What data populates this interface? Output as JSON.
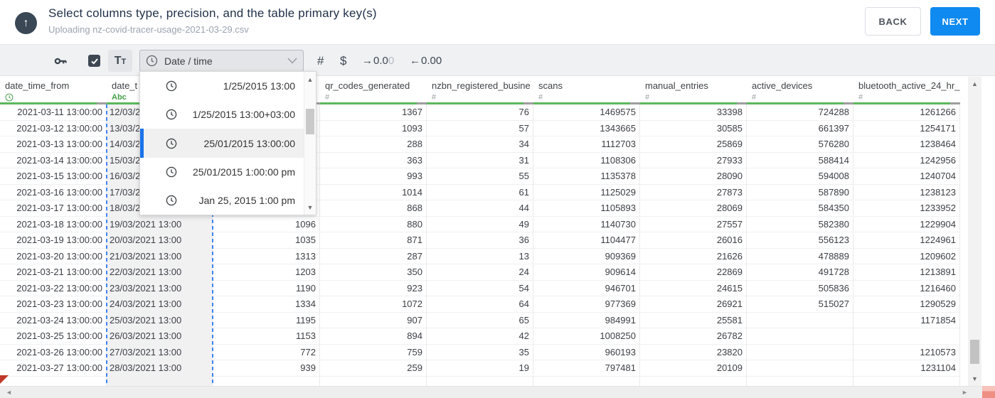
{
  "header": {
    "title": "Select columns type, precision, and the table primary key(s)",
    "subtitle": "Uploading nz-covid-tracer-usage-2021-03-29.csv",
    "back_label": "BACK",
    "next_label": "NEXT"
  },
  "toolbar": {
    "text_type_label": "Tt",
    "type_dropdown_value": "Date / time",
    "number_symbol": "#",
    "currency_symbol": "$",
    "increase_decimal": {
      "arrow": "→",
      "value": "0.0",
      "faded": "0"
    },
    "decrease_decimal": {
      "arrow": "←",
      "value": "0.00"
    },
    "checkbox_checked": true
  },
  "type_dropdown": {
    "selected_index": 2,
    "options": [
      {
        "label": "1/25/2015 13:00"
      },
      {
        "label": "1/25/2015 13:00+03:00"
      },
      {
        "label": "25/01/2015 13:00:00"
      },
      {
        "label": "25/01/2015 1:00:00 pm"
      },
      {
        "label": "Jan 25, 2015 1:00 pm"
      }
    ]
  },
  "table": {
    "columns": [
      {
        "name": "date_time_from",
        "type": "clock",
        "align": "right",
        "selected": false
      },
      {
        "name": "date_t",
        "type": "Abc",
        "align": "left",
        "selected": true
      },
      {
        "name": "",
        "type": "",
        "align": "right",
        "selected": false
      },
      {
        "name": "qr_codes_generated",
        "type": "#",
        "align": "right",
        "selected": false
      },
      {
        "name": "nzbn_registered_busine",
        "type": "#",
        "align": "right",
        "selected": false
      },
      {
        "name": "scans",
        "type": "#",
        "align": "right",
        "selected": false
      },
      {
        "name": "manual_entries",
        "type": "#",
        "align": "right",
        "selected": false
      },
      {
        "name": "active_devices",
        "type": "#",
        "align": "right",
        "selected": false
      },
      {
        "name": "bluetooth_active_24_hr_",
        "type": "#",
        "align": "right",
        "selected": false
      }
    ],
    "rows": [
      [
        "2021-03-11 13:00:00",
        "12/03/2",
        "",
        "1367",
        "76",
        "1469575",
        "33398",
        "724288",
        "1261266"
      ],
      [
        "2021-03-12 13:00:00",
        "13/03/2",
        "",
        "1093",
        "57",
        "1343665",
        "30585",
        "661397",
        "1254171"
      ],
      [
        "2021-03-13 13:00:00",
        "14/03/2",
        "",
        "288",
        "34",
        "1112703",
        "25869",
        "576280",
        "1238464"
      ],
      [
        "2021-03-14 13:00:00",
        "15/03/2",
        "",
        "363",
        "31",
        "1108306",
        "27933",
        "588414",
        "1242956"
      ],
      [
        "2021-03-15 13:00:00",
        "16/03/2",
        "",
        "993",
        "55",
        "1135378",
        "28090",
        "594008",
        "1240704"
      ],
      [
        "2021-03-16 13:00:00",
        "17/03/2",
        "",
        "1014",
        "61",
        "1125029",
        "27873",
        "587890",
        "1238123"
      ],
      [
        "2021-03-17 13:00:00",
        "18/03/2",
        "",
        "868",
        "44",
        "1105893",
        "28069",
        "584350",
        "1233952"
      ],
      [
        "2021-03-18 13:00:00",
        "19/03/2021 13:00",
        "1096",
        "880",
        "49",
        "1140730",
        "27557",
        "582380",
        "1229904"
      ],
      [
        "2021-03-19 13:00:00",
        "20/03/2021 13:00",
        "1035",
        "871",
        "36",
        "1104477",
        "26016",
        "556123",
        "1224961"
      ],
      [
        "2021-03-20 13:00:00",
        "21/03/2021 13:00",
        "1313",
        "287",
        "13",
        "909369",
        "21626",
        "478889",
        "1209602"
      ],
      [
        "2021-03-21 13:00:00",
        "22/03/2021 13:00",
        "1203",
        "350",
        "24",
        "909614",
        "22869",
        "491728",
        "1213891"
      ],
      [
        "2021-03-22 13:00:00",
        "23/03/2021 13:00",
        "1190",
        "923",
        "54",
        "946701",
        "24615",
        "505836",
        "1216460"
      ],
      [
        "2021-03-23 13:00:00",
        "24/03/2021 13:00",
        "1334",
        "1072",
        "64",
        "977369",
        "26921",
        "515027",
        "1290529"
      ],
      [
        "2021-03-24 13:00:00",
        "25/03/2021 13:00",
        "1195",
        "907",
        "65",
        "984991",
        "25581",
        "",
        "1171854"
      ],
      [
        "2021-03-25 13:00:00",
        "26/03/2021 13:00",
        "1153",
        "894",
        "42",
        "1008250",
        "26782",
        "",
        ""
      ],
      [
        "2021-03-26 13:00:00",
        "27/03/2021 13:00",
        "772",
        "759",
        "35",
        "960193",
        "23820",
        "",
        "1210573"
      ],
      [
        "2021-03-27 13:00:00",
        "28/03/2021 13:00",
        "939",
        "259",
        "19",
        "797481",
        "20109",
        "",
        "1231104"
      ]
    ]
  },
  "icons": {
    "upload_arrow": "↑",
    "scroll_up": "▲",
    "scroll_down": "▼",
    "scroll_left": "◄",
    "scroll_right": "►"
  },
  "colors": {
    "next_button_blue": "#0f8af0",
    "type_green": "#43a047",
    "header_underline_green": "#5cb85c",
    "column_selection_blue": "#3f83f1",
    "selected_option_bar_blue": "#1a73e8",
    "toolbar_icon_dark": "#3d4852",
    "corner_marker_red": "#c0392b",
    "corner_scrollbar_salmon": "#ef8e82"
  }
}
